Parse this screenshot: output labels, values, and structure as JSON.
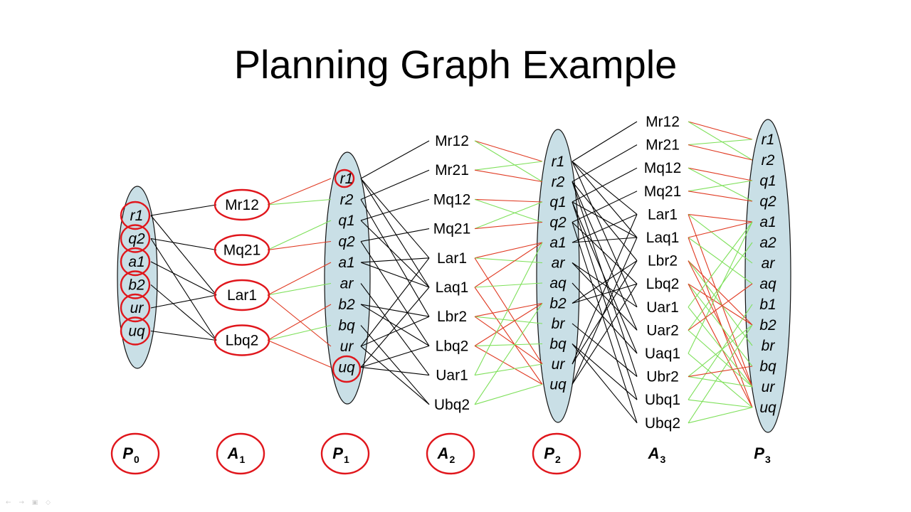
{
  "title": "Planning Graph Example",
  "colors": {
    "oval": "#c9dfe6",
    "mutex": "#e03a22",
    "support": "#7ee05a",
    "edge": "#000000",
    "circle": "#e0161c"
  },
  "levels": {
    "P0": {
      "label": "P",
      "sub": "0",
      "items": [
        "r1",
        "q2",
        "a1",
        "b2",
        "ur",
        "uq"
      ]
    },
    "A1": {
      "label": "A",
      "sub": "1",
      "items": [
        "Mr12",
        "Mq21",
        "Lar1",
        "Lbq2"
      ]
    },
    "P1": {
      "label": "P",
      "sub": "1",
      "items": [
        "r1",
        "r2",
        "q1",
        "q2",
        "a1",
        "ar",
        "b2",
        "bq",
        "ur",
        "uq"
      ]
    },
    "A2": {
      "label": "A",
      "sub": "2",
      "items": [
        "Mr12",
        "Mr21",
        "Mq12",
        "Mq21",
        "Lar1",
        "Laq1",
        "Lbr2",
        "Lbq2",
        "Uar1",
        "Ubq2"
      ]
    },
    "P2": {
      "label": "P",
      "sub": "2",
      "items": [
        "r1",
        "r2",
        "q1",
        "q2",
        "a1",
        "ar",
        "aq",
        "b2",
        "br",
        "bq",
        "ur",
        "uq"
      ]
    },
    "A3": {
      "label": "A",
      "sub": "3",
      "items": [
        "Mr12",
        "Mr21",
        "Mq12",
        "Mq21",
        "Lar1",
        "Laq1",
        "Lbr2",
        "Lbq2",
        "Uar1",
        "Uar2",
        "Uaq1",
        "Ubr2",
        "Ubq1",
        "Ubq2"
      ]
    },
    "P3": {
      "label": "P",
      "sub": "3",
      "items": [
        "r1",
        "r2",
        "q1",
        "q2",
        "a1",
        "a2",
        "ar",
        "aq",
        "b1",
        "b2",
        "br",
        "bq",
        "ur",
        "uq"
      ]
    }
  },
  "footer": {
    "toolbar": "← → ▣ ◇"
  }
}
